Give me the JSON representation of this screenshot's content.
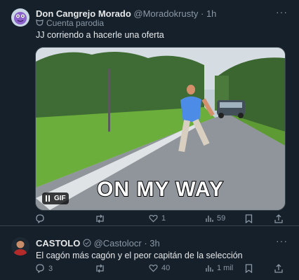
{
  "tweet1": {
    "display_name": "Don Cangrejo Morado",
    "handle": "@Moradokrusty",
    "separator": "·",
    "time": "1h",
    "parody_label": "Cuenta parodia",
    "text": "JJ corriendo a hacerle una oferta",
    "media": {
      "overlay_text": "ON MY WAY",
      "gif_label": "GIF"
    },
    "stats": {
      "replies": "",
      "retweets": "",
      "likes": "1",
      "views": "59"
    }
  },
  "tweet2": {
    "display_name": "CASTOLO",
    "handle": "@Castolocr",
    "separator": "·",
    "time": "3h",
    "text": "El cagón más cagón y el peor capitán de la selección",
    "stats": {
      "replies": "3",
      "retweets": "",
      "likes": "40",
      "views": "1 mil"
    }
  },
  "colors": {
    "background": "#15202b",
    "text": "#e7e9ea",
    "muted": "#8b98a5",
    "divider": "#38444d"
  }
}
